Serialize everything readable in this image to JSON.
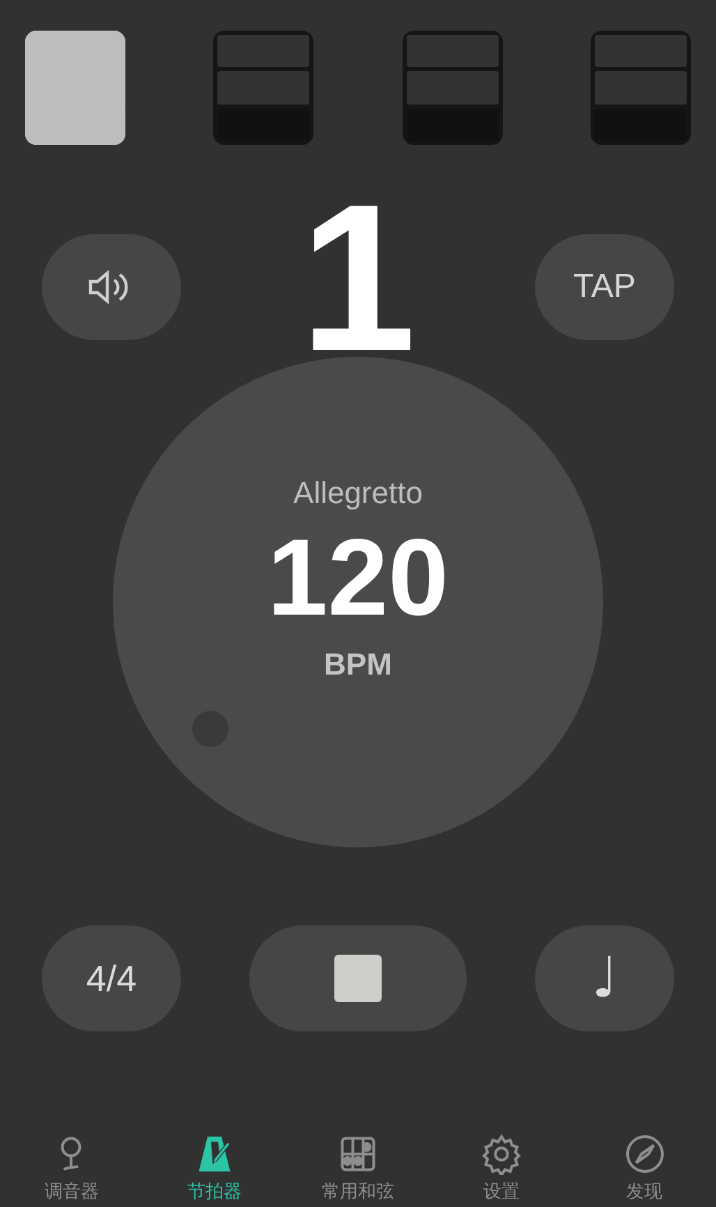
{
  "beats": [
    {
      "selected": true
    },
    {
      "selected": false
    },
    {
      "selected": false
    },
    {
      "selected": false
    }
  ],
  "beat_number": "1",
  "tap_button": "TAP",
  "dial": {
    "tempo_name": "Allegretto",
    "bpm": "120",
    "unit": "BPM"
  },
  "time_signature": "4/4",
  "playing": true,
  "note_value": "♩",
  "tabs": [
    {
      "label": "调音器",
      "kind": "pin",
      "selected": false
    },
    {
      "label": "节拍器",
      "kind": "metronome",
      "selected": true
    },
    {
      "label": "常用和弦",
      "kind": "chord",
      "selected": false
    },
    {
      "label": "设置",
      "kind": "gear",
      "selected": false
    },
    {
      "label": "发现",
      "kind": "compass",
      "selected": false
    }
  ]
}
